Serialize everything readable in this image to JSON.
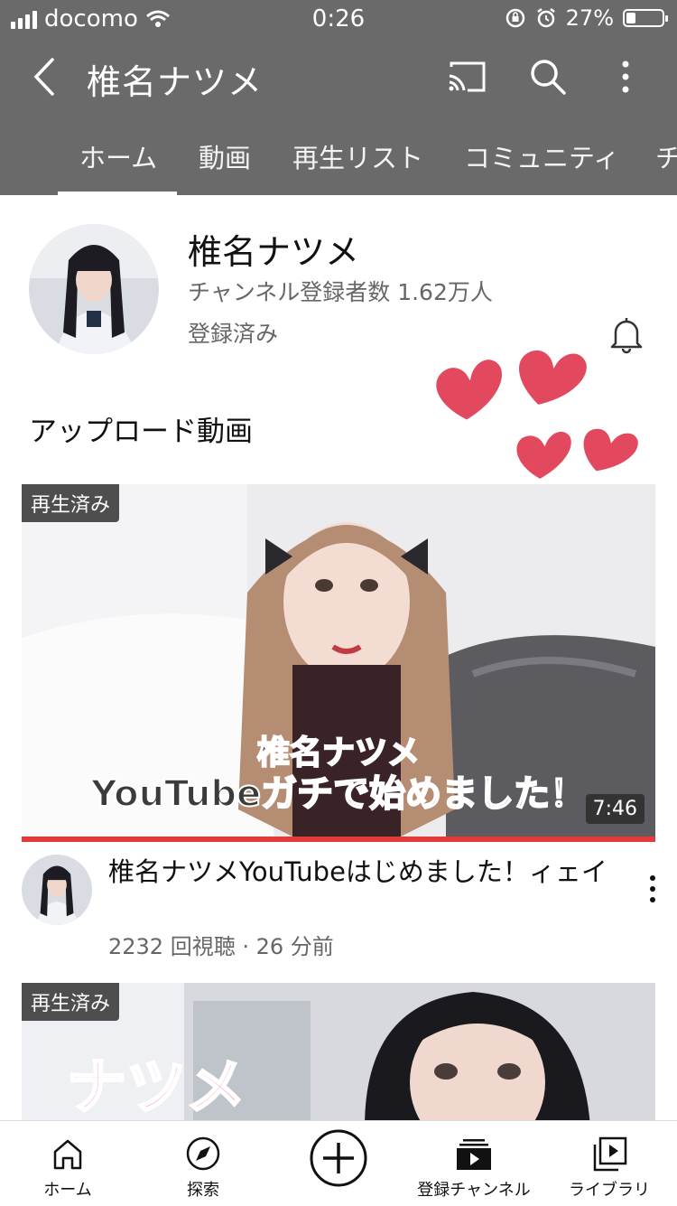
{
  "status_bar": {
    "carrier": "docomo",
    "time": "0:26",
    "battery_percent": "27%",
    "battery_level": 0.27
  },
  "app_bar": {
    "title": "椎名ナツメ",
    "icons": [
      "back-icon",
      "cast-icon",
      "search-icon",
      "more-vertical-icon"
    ]
  },
  "tabs": [
    {
      "label": "ホーム",
      "active": true
    },
    {
      "label": "動画"
    },
    {
      "label": "再生リスト"
    },
    {
      "label": "コミュニティ"
    },
    {
      "label": "チ"
    }
  ],
  "channel": {
    "name": "椎名ナツメ",
    "subscribers": "チャンネル登録者数 1.62万人",
    "subscribed_label": "登録済み"
  },
  "section": {
    "title": "アップロード動画"
  },
  "videos": [
    {
      "watched_badge": "再生済み",
      "overlay_line1": "椎名ナツメ",
      "overlay_line2": "YouTubeガチで始めました！",
      "duration": "7:46",
      "watch_progress": 1.0,
      "title": "椎名ナツメYouTubeはじめました！ィェイ",
      "meta": "2232 回視聴 · 26 分前"
    },
    {
      "watched_badge": "再生済み",
      "overlay_text": "ナツメ"
    }
  ],
  "bottom_nav": [
    {
      "label": "ホーム",
      "icon": "home-icon"
    },
    {
      "label": "探索",
      "icon": "explore-icon"
    },
    {
      "label": "",
      "icon": "create-icon"
    },
    {
      "label": "登録チャンネル",
      "icon": "subscriptions-icon"
    },
    {
      "label": "ライブラリ",
      "icon": "library-icon"
    }
  ],
  "colors": {
    "header_bg": "#6a6a6a",
    "progress_red": "#e43a3a",
    "heart": "#e2495e"
  }
}
